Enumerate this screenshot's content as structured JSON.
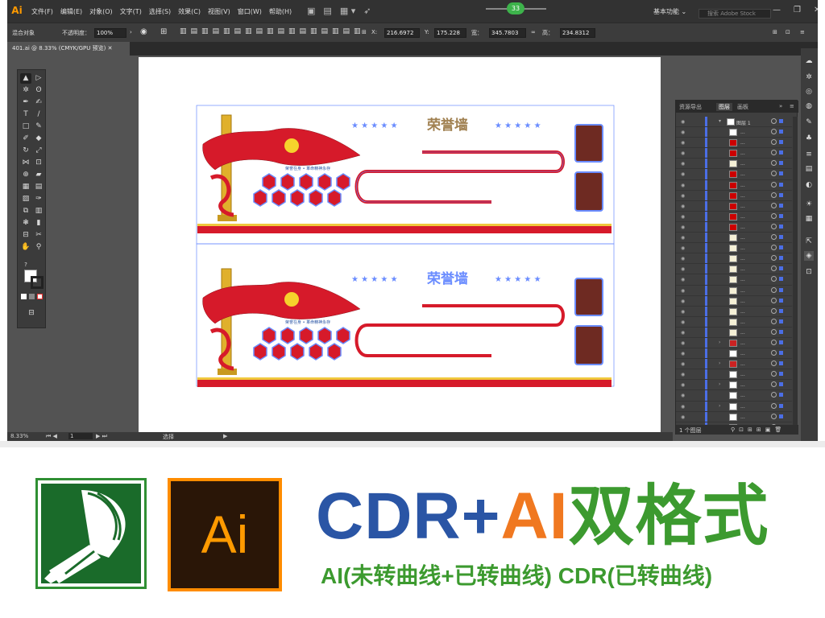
{
  "app": {
    "logo": "Ai",
    "menus": [
      "文件(F)",
      "编辑(E)",
      "对象(O)",
      "文字(T)",
      "选择(S)",
      "效果(C)",
      "视图(V)",
      "窗口(W)",
      "帮助(H)"
    ],
    "badge": "33",
    "workspace": "基本功能",
    "search_placeholder": "搜索 Adobe Stock"
  },
  "control_bar": {
    "object_label": "混合对象",
    "opacity_label": "不透明度：",
    "opacity_value": "100%",
    "x_label": "X:",
    "x_value": "216.6972",
    "y_label": "Y:",
    "y_value": "175.228",
    "w_label": "宽：",
    "w_value": "345.7803",
    "h_label": "高：",
    "h_value": "234.8312"
  },
  "document": {
    "tab": "401.ai @ 8.33% (CMYK/GPU 预览)"
  },
  "artwork": {
    "title": "荣誉墙",
    "slogan": "荣誉在身 • 革命精神永存"
  },
  "status": {
    "zoom": "8.33%",
    "artboard": "1",
    "tool": "选择"
  },
  "layers_panel": {
    "tabs": [
      "资源导出",
      "图层",
      "画板"
    ],
    "active_tab": "图层",
    "top_layer": "图层 1",
    "row_name": "...",
    "footer": "1 个图层",
    "row_colors": [
      "#ffffff",
      "#cc0000",
      "#cc0000",
      "#f5f0d6",
      "#cc0000",
      "#cc0000",
      "#cc0000",
      "#cc0000",
      "#cc0000",
      "#cc0000",
      "#f5f0d6",
      "#f5f0d6",
      "#f5f0d6",
      "#f5f0d6",
      "#f5f0d6",
      "#f5f0d6",
      "#f5f0d6",
      "#f5f0d6",
      "#f5f0d6",
      "#f5f0d6",
      "#cc2222",
      "#ffffff",
      "#cc2222",
      "#ffffff",
      "#ffffff",
      "#ffffff",
      "#ffffff",
      "#ffffff",
      "#cc2222"
    ]
  },
  "banner": {
    "cdr": "CDR",
    "plus1": "+",
    "ai": "AI",
    "dual": "双格式",
    "sub_ai": "AI(未转曲线+已转曲线)",
    "sub_cdr": " CDR(已转曲线)",
    "ai_logo_text": "Ai",
    "colors": {
      "blue": "#2a55a5",
      "orange": "#f07820",
      "green": "#3c9a2f"
    }
  }
}
